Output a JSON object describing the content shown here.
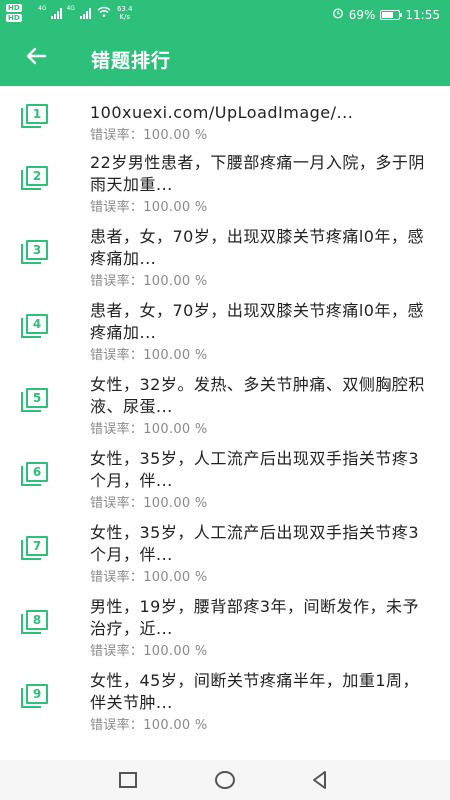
{
  "status_bar": {
    "hd1": "HD",
    "hd2": "HD",
    "net1": "4G",
    "net2": "4G",
    "speed_value": "63.4",
    "speed_unit": "K/s",
    "battery_percent": "69%",
    "battery_level": 0.69,
    "time": "11:55"
  },
  "app_bar": {
    "back_icon": "arrow-left-icon",
    "title": "错题排行"
  },
  "colors": {
    "accent": "#2dc07a",
    "text": "#222222",
    "subtext": "#8a8a8a"
  },
  "list": {
    "items": [
      {
        "rank": "1",
        "title": "100xuexi.com/UpLoadImage/...",
        "rate": "错误率：100.00 %"
      },
      {
        "rank": "2",
        "title": "22岁男性患者，下腰部疼痛一月入院，多于阴雨天加重...",
        "rate": "错误率：100.00 %"
      },
      {
        "rank": "3",
        "title": "患者，女，70岁，出现双膝关节疼痛l0年，感疼痛加...",
        "rate": "错误率：100.00 %"
      },
      {
        "rank": "4",
        "title": "患者，女，70岁，出现双膝关节疼痛l0年，感疼痛加...",
        "rate": "错误率：100.00 %"
      },
      {
        "rank": "5",
        "title": "女性，32岁。发热、多关节肿痛、双侧胸腔积液、尿蛋...",
        "rate": "错误率：100.00 %"
      },
      {
        "rank": "6",
        "title": "女性，35岁，人工流产后出现双手指关节疼3个月，伴...",
        "rate": "错误率：100.00 %"
      },
      {
        "rank": "7",
        "title": "女性，35岁，人工流产后出现双手指关节疼3个月，伴...",
        "rate": "错误率：100.00 %"
      },
      {
        "rank": "8",
        "title": "男性，19岁，腰背部疼3年，间断发作，未予治疗，近...",
        "rate": "错误率：100.00 %"
      },
      {
        "rank": "9",
        "title": "女性，45岁，间断关节疼痛半年，加重1周，伴关节肿...",
        "rate": "错误率：100.00 %"
      }
    ]
  },
  "nav_bar": {
    "recent_icon": "square-icon",
    "home_icon": "circle-icon",
    "back_icon": "triangle-back-icon"
  }
}
